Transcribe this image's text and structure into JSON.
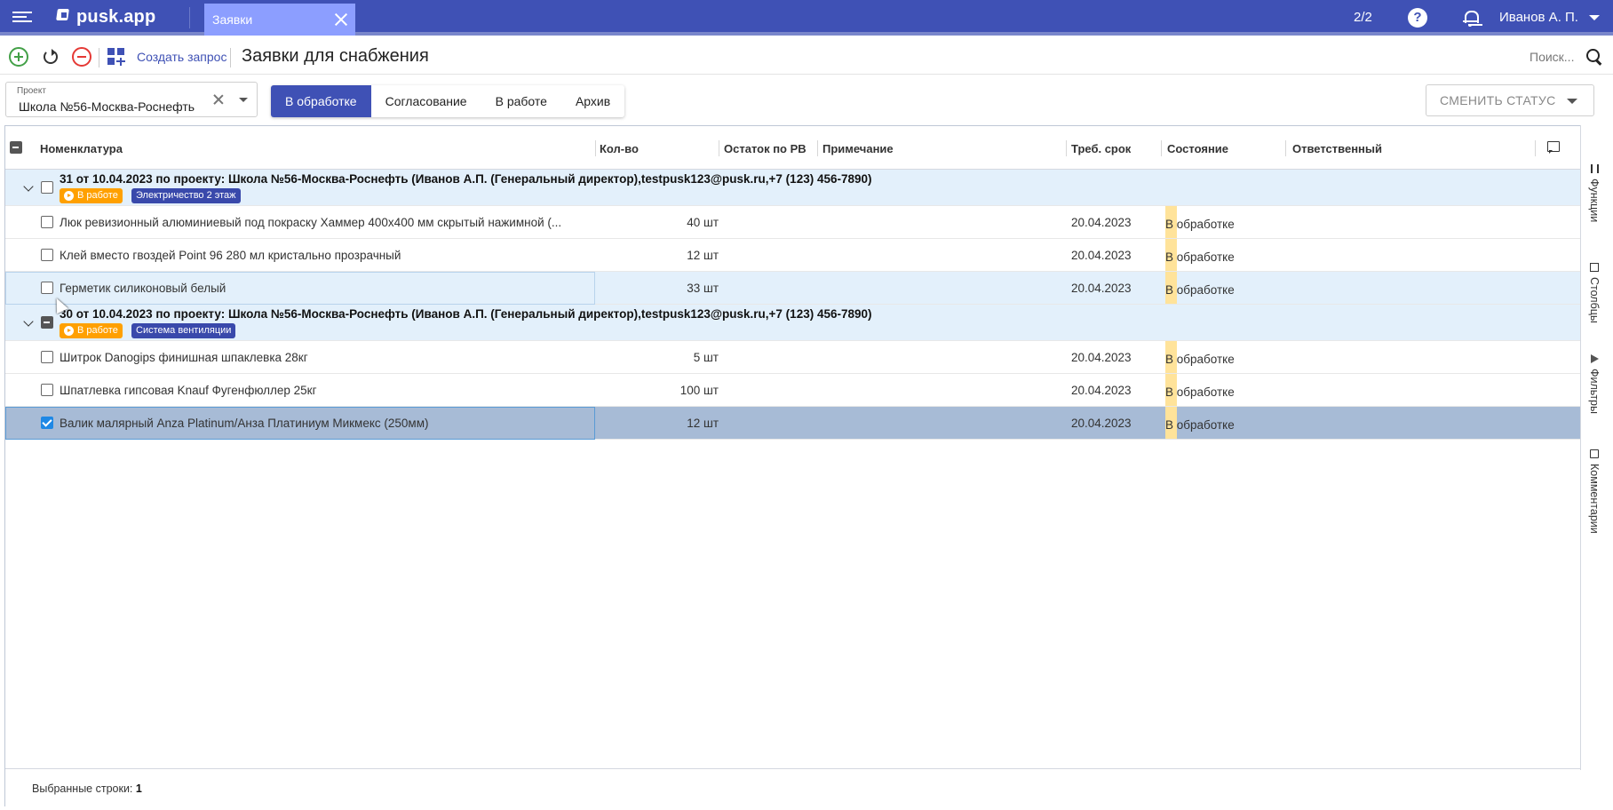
{
  "app": {
    "logo": "pusk.app",
    "tab_label": "Заявки",
    "page_counter": "2/2",
    "help_label": "?",
    "user_name": "Иванов А. П."
  },
  "toolbar": {
    "create_label": "Создать запрос",
    "title": "Заявки для снабжения",
    "search_placeholder": "Поиск..."
  },
  "filter": {
    "project_label": "Проект",
    "project_value": "Школа №56-Москва-Роснефть",
    "segments": [
      "В обработке",
      "Согласование",
      "В работе",
      "Архив"
    ],
    "active_segment": "В обработке",
    "change_status_label": "СМЕНИТЬ СТАТУС"
  },
  "grid": {
    "columns": [
      "Номенклатура",
      "Кол-во",
      "Остаток по РВ",
      "Примечание",
      "Треб. срок",
      "Состояние",
      "Ответственный"
    ],
    "groups": [
      {
        "title": "31 от 10.04.2023 по проекту: Школа №56-Москва-Роснефть (Иванов А.П. (Генеральный директор),testpusk123@pusk.ru,+7 (123) 456-7890)",
        "status_chip": "В работе",
        "category_chip": "Электричество 2 этаж",
        "items": [
          {
            "name": "Люк ревизионный алюминиевый под покраску Хаммер 400x400 мм скрытый нажимной (...",
            "qty": "40 шт",
            "date": "20.04.2023",
            "state": "В обработке"
          },
          {
            "name": "Клей вместо гвоздей Point 96 280 мл кристально прозрачный",
            "qty": "12 шт",
            "date": "20.04.2023",
            "state": "В обработке"
          },
          {
            "name": "Герметик силиконовый белый",
            "qty": "33 шт",
            "date": "20.04.2023",
            "state": "В обработке"
          }
        ]
      },
      {
        "title": "30 от 10.04.2023 по проекту: Школа №56-Москва-Роснефть (Иванов А.П. (Генеральный директор),testpusk123@pusk.ru,+7 (123) 456-7890)",
        "status_chip": "В работе",
        "category_chip": "Система вентиляции",
        "items": [
          {
            "name": "Шитрок Danogips финишная шпаклевка 28кг",
            "qty": "5 шт",
            "date": "20.04.2023",
            "state": "В обработке"
          },
          {
            "name": "Шпатлевка гипсовая Knauf Фугенфюллер 25кг",
            "qty": "100 шт",
            "date": "20.04.2023",
            "state": "В обработке"
          },
          {
            "name": "Валик малярный Anza Platinum/Анза Платиниум Микмекс (250мм)",
            "qty": "12 шт",
            "date": "20.04.2023",
            "state": "В обработке"
          }
        ]
      }
    ],
    "footer_label": "Выбранные строки:",
    "footer_count": "1"
  },
  "sidebar": {
    "items": [
      "Функции",
      "Столбцы",
      "Фильтры",
      "Комментарии"
    ]
  },
  "colors": {
    "primary": "#3f51b5",
    "tab_active": "#8c9eff",
    "chip_orange": "#ffa000",
    "chip_blue": "#3949ab",
    "state_bar": "#ffe39a",
    "group_bg": "#e3f0fb",
    "selected_row": "#a7bbd6"
  }
}
